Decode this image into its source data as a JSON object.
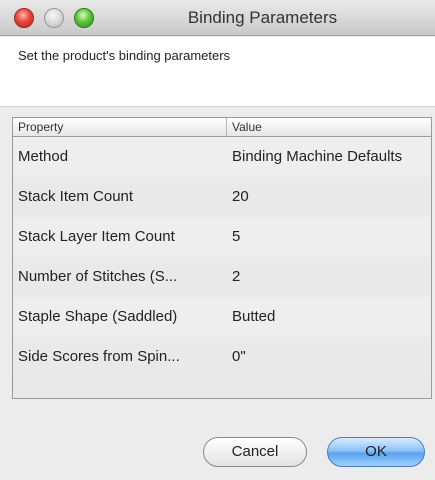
{
  "window": {
    "title": "Binding Parameters"
  },
  "instruction": "Set the product's binding parameters",
  "table": {
    "headers": {
      "property": "Property",
      "value": "Value"
    },
    "rows": [
      {
        "property": "Method",
        "value": "Binding Machine Defaults"
      },
      {
        "property": "Stack Item Count",
        "value": "20"
      },
      {
        "property": "Stack Layer Item Count",
        "value": "5"
      },
      {
        "property": "Number of Stitches (S...",
        "value": "2"
      },
      {
        "property": "Staple Shape (Saddled)",
        "value": "Butted"
      },
      {
        "property": "Side Scores from Spin...",
        "value": "0\""
      }
    ]
  },
  "buttons": {
    "cancel": "Cancel",
    "ok": "OK"
  }
}
